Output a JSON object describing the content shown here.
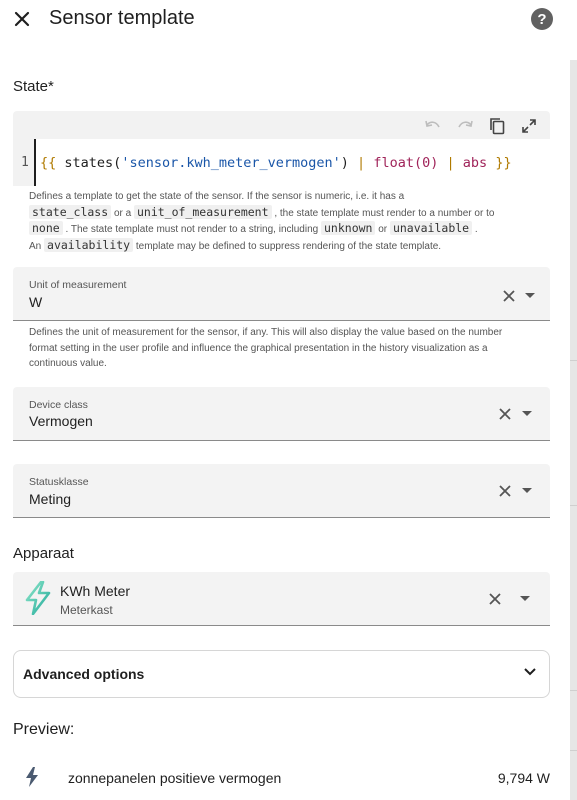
{
  "dialog": {
    "title": "Sensor template",
    "close_icon": "close-icon",
    "help_icon": "help-icon",
    "help_glyph": "?"
  },
  "state": {
    "label": "State*",
    "toolbar": [
      "undo-icon",
      "redo-icon",
      "copy-icon",
      "fullscreen-icon"
    ],
    "line_number": "1",
    "code": {
      "open": "{{",
      "fn": "states(",
      "str": "'sensor.kwh_meter_vermogen'",
      "fn_close": ")",
      "pipe1": "|",
      "filter1": "float(0)",
      "pipe2": "|",
      "filter2": "abs",
      "close": "}}"
    },
    "helper": {
      "t1": "Defines a template to get the state of the sensor. If the sensor is numeric, i.e. it has a",
      "c1": "state_class",
      "t2": "or a",
      "c2": "unit_of_measurement",
      "t3": ", the state template must render to a number or to",
      "c3": "none",
      "t4": ". The state template must not render to a string, including",
      "c4": "unknown",
      "t5": "or",
      "c5": "unavailable",
      "t6": ".",
      "t7": "An",
      "c6": "availability",
      "t8": "template may be defined to suppress rendering of the state template."
    }
  },
  "unit": {
    "label": "Unit of measurement",
    "value": "W",
    "helper": "Defines the unit of measurement for the sensor, if any. This will also display the value based on the number format setting in the user profile and influence the graphical presentation in the history visualization as a continuous value."
  },
  "device_class": {
    "label": "Device class",
    "value": "Vermogen"
  },
  "state_class": {
    "label": "Statusklasse",
    "value": "Meting"
  },
  "device": {
    "label": "Apparaat",
    "name": "KWh Meter",
    "area": "Meterkast",
    "icon": "lightning-bolt-icon"
  },
  "advanced": {
    "label": "Advanced options"
  },
  "preview": {
    "label": "Preview:",
    "entity_name": "zonnepanelen positieve vermogen",
    "entity_value": "9,794 W",
    "icon": "flash-icon"
  },
  "colors": {
    "accent_gradient": [
      "#7be0c2",
      "#28b8a6"
    ],
    "icon_gray": "#616161"
  }
}
